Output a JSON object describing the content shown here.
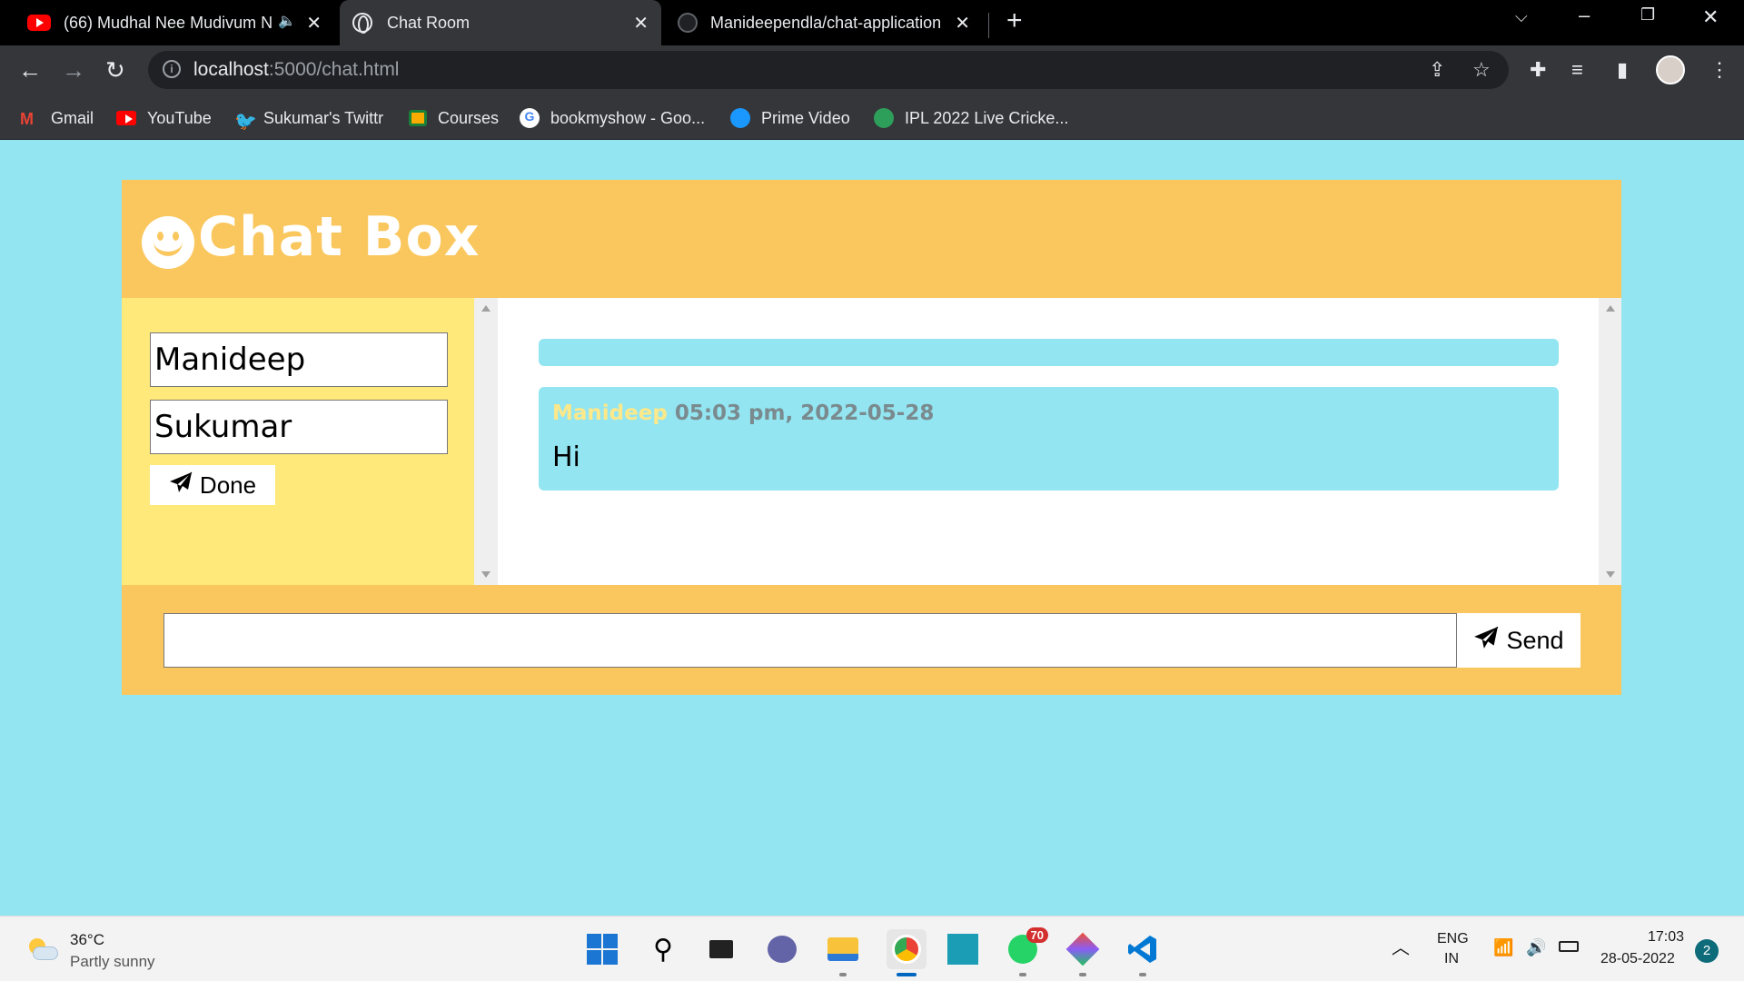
{
  "browser": {
    "tabs": [
      {
        "title": "(66) Mudhal Nee Mudivum N",
        "favicon": "youtube-icon",
        "audio": "speaker-icon"
      },
      {
        "title": "Chat Room",
        "favicon": "globe-icon"
      },
      {
        "title": "Manideependla/chat-application",
        "favicon": "github-icon"
      }
    ],
    "address": {
      "host": "localhost",
      "path": ":5000/chat.html"
    },
    "bookmarks": [
      {
        "label": "Gmail",
        "icon": "gmail-icon",
        "color": "#ea4335"
      },
      {
        "label": "YouTube",
        "icon": "youtube-icon",
        "color": "#ff0000"
      },
      {
        "label": "Sukumar's Twittr",
        "icon": "twitter-icon",
        "color": "#1d9bf0"
      },
      {
        "label": "Courses",
        "icon": "classroom-icon",
        "color": "#f9ab00"
      },
      {
        "label": "bookmyshow - Goo...",
        "icon": "google-icon",
        "color": "#ffffff"
      },
      {
        "label": "Prime Video",
        "icon": "prime-video-icon",
        "color": "#1a98ff"
      },
      {
        "label": "IPL 2022 Live Cricke...",
        "icon": "cricbuzz-icon",
        "color": "#2e9f5a"
      }
    ]
  },
  "chat": {
    "title": "Chat Box",
    "sender_value": "Manideep",
    "receiver_value": "Sukumar",
    "done_label": "Done",
    "messages": [
      {
        "sender": "Manideep",
        "time": "05:03 pm, 2022-05-28",
        "text": "Hi"
      }
    ],
    "send_label": "Send",
    "message_value": "",
    "colors": {
      "background": "#92e5f1",
      "panel": "#fac75e",
      "side": "#ffe97a"
    }
  },
  "taskbar": {
    "weather": {
      "temp": "36°C",
      "desc": "Partly sunny"
    },
    "whatsapp_badge": "70",
    "lang": "ENG",
    "region": "IN",
    "time": "17:03",
    "date": "28-05-2022",
    "notifications": "2"
  }
}
